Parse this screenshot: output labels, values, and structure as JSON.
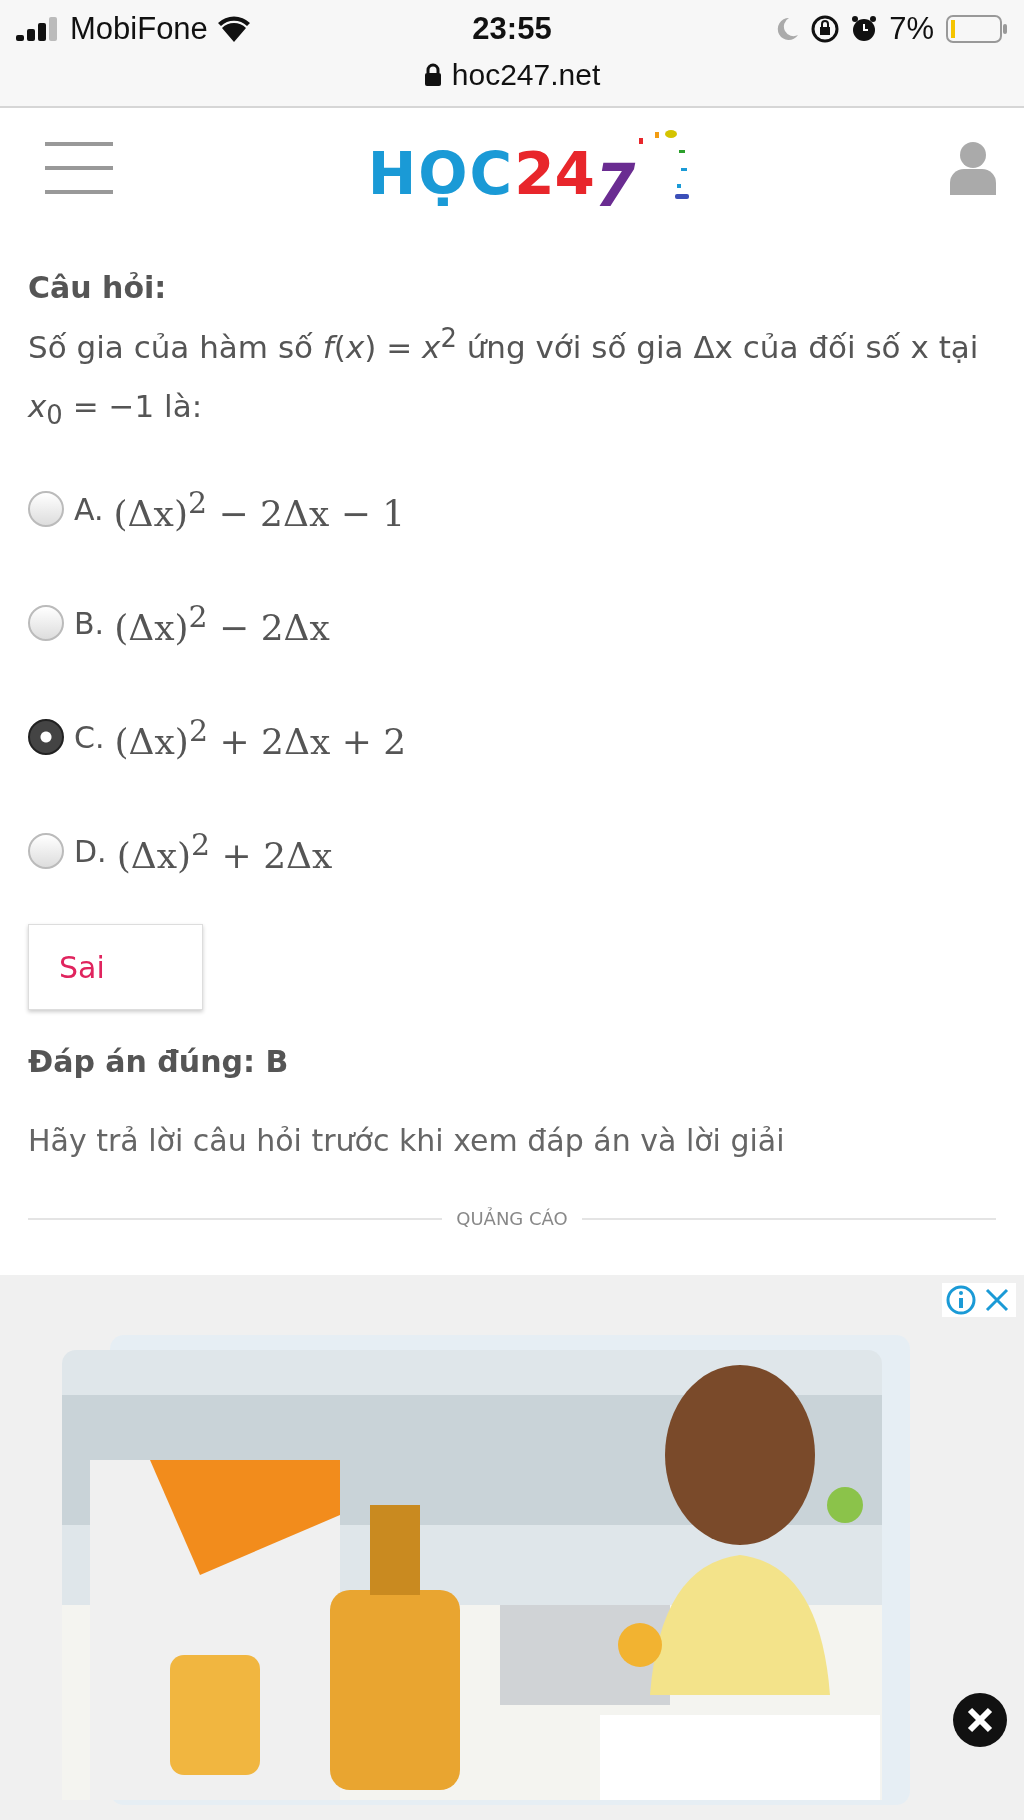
{
  "status_bar": {
    "carrier": "MobiFone",
    "time": "23:55",
    "battery": "7%"
  },
  "address_bar": {
    "url": "hoc247.net"
  },
  "logo": [
    {
      "text": "HỌC",
      "color": "#1a9ad6"
    },
    {
      "text": "24",
      "color": "#e8262b"
    },
    {
      "text": "7",
      "color": "#6a2c91"
    }
  ],
  "question": {
    "title": "Câu hỏi:",
    "text": "Số gia của hàm số *f*(*x*) = *x*$^{2}$ ứng với số gia Δx của đối số x tại *x*$_{0}$ = −1 là:"
  },
  "options": [
    {
      "letter": "A.",
      "formula": "(Δx)$^{2}$ − 2Δx − 1",
      "selected": false
    },
    {
      "letter": "B.",
      "formula": "(Δx)$^{2}$ − 2Δx",
      "selected": false
    },
    {
      "letter": "C.",
      "formula": "(Δx)$^{2}$ + 2Δx + 2",
      "selected": true
    },
    {
      "letter": "D.",
      "formula": "(Δx)$^{2}$ + 2Δx",
      "selected": false
    }
  ],
  "result": {
    "label": "Sai"
  },
  "correct_answer": "Đáp án đúng: B",
  "hint": "Hãy trả lời câu hỏi trước khi xem đáp án và lời giải",
  "ad_divider": "QUẢNG CÁO"
}
